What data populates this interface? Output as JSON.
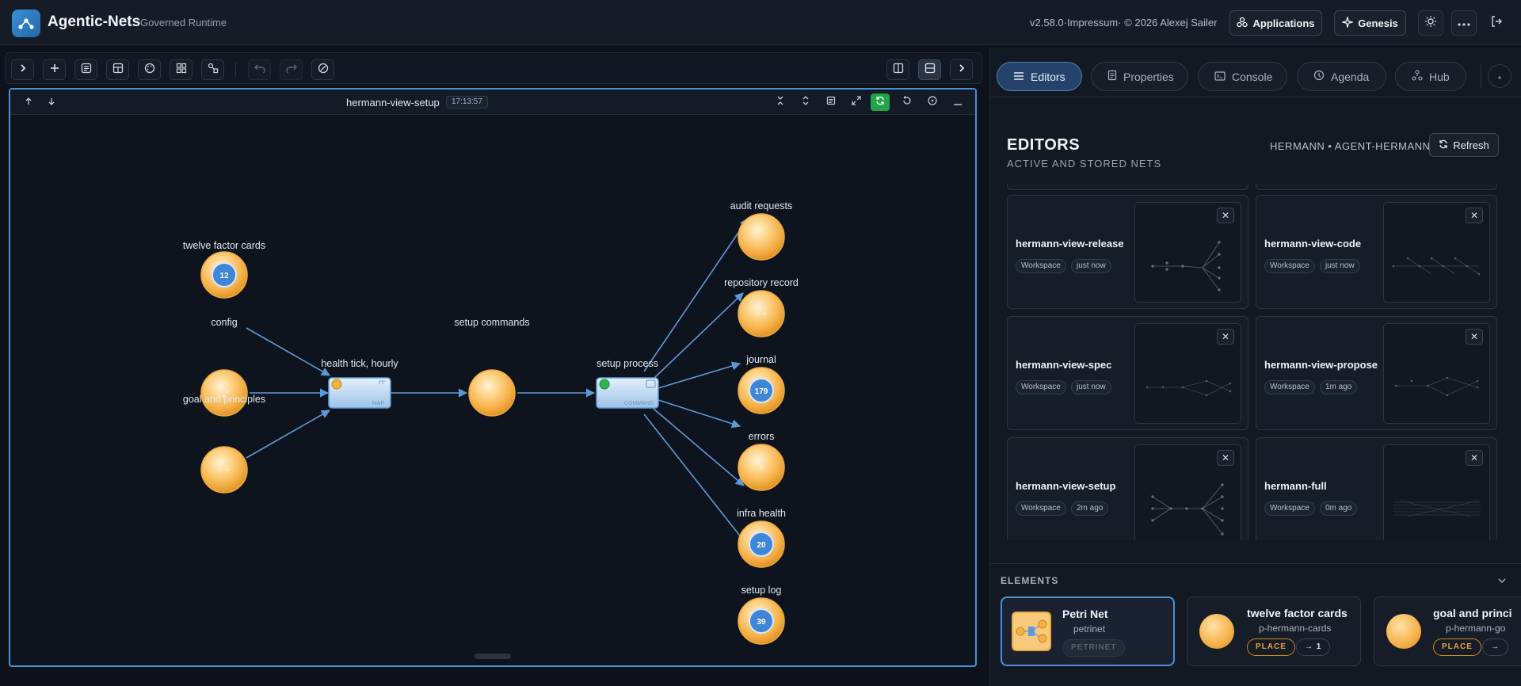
{
  "header": {
    "app_title": "Agentic-Nets",
    "app_subtitle": "Governed Runtime",
    "version_text": "v2.58.0·Impressum· © 2026 Alexej Sailer",
    "applications_label": "Applications",
    "genesis_label": "Genesis"
  },
  "canvas": {
    "title": "hermann-view-setup",
    "time": "17:13:57",
    "places": [
      {
        "label": "twelve factor cards",
        "count": "12"
      },
      {
        "label": "config",
        "count": ""
      },
      {
        "label": "goal and principles",
        "count": ""
      },
      {
        "label": "setup commands",
        "count": ""
      },
      {
        "label": "audit requests",
        "count": ""
      },
      {
        "label": "repository record",
        "count": ""
      },
      {
        "label": "journal",
        "count": "179"
      },
      {
        "label": "errors",
        "count": ""
      },
      {
        "label": "infra health",
        "count": "20"
      },
      {
        "label": "setup log",
        "count": "39"
      }
    ],
    "transitions": [
      {
        "label": "health tick, hourly",
        "kind": "MAP"
      },
      {
        "label": "setup process",
        "kind": "COMMAND"
      }
    ]
  },
  "right": {
    "tabs": [
      "Editors",
      "Properties",
      "Console",
      "Agenda",
      "Hub"
    ],
    "editors_title": "EDITORS",
    "editors_subtitle": "ACTIVE AND STORED NETS",
    "owner": "HERMANN • AGENT-HERMANN",
    "refresh_label": "Refresh",
    "cards": [
      {
        "name": "hermann-view-release",
        "tag": "Workspace",
        "time": "just now"
      },
      {
        "name": "hermann-view-code",
        "tag": "Workspace",
        "time": "just now"
      },
      {
        "name": "hermann-view-spec",
        "tag": "Workspace",
        "time": "just now"
      },
      {
        "name": "hermann-view-propose",
        "tag": "Workspace",
        "time": "1m ago"
      },
      {
        "name": "hermann-view-setup",
        "tag": "Workspace",
        "time": "2m ago"
      },
      {
        "name": "hermann-full",
        "tag": "Workspace",
        "time": "0m ago"
      }
    ],
    "elements_title": "ELEMENTS",
    "elements": [
      {
        "name": "Petri Net",
        "id": "petrinet",
        "tag": "PETRINET",
        "arrow": ""
      },
      {
        "name": "twelve factor cards",
        "id": "p-hermann-cards",
        "tag": "PLACE",
        "arrow": "→ 1"
      },
      {
        "name": "goal and princi",
        "id": "p-hermann-go",
        "tag": "PLACE",
        "arrow": "→"
      }
    ]
  },
  "colors": {
    "accent": "#4f8fd4",
    "place": "#f5b047",
    "token": "#3f86d8",
    "green": "#23a44a"
  }
}
